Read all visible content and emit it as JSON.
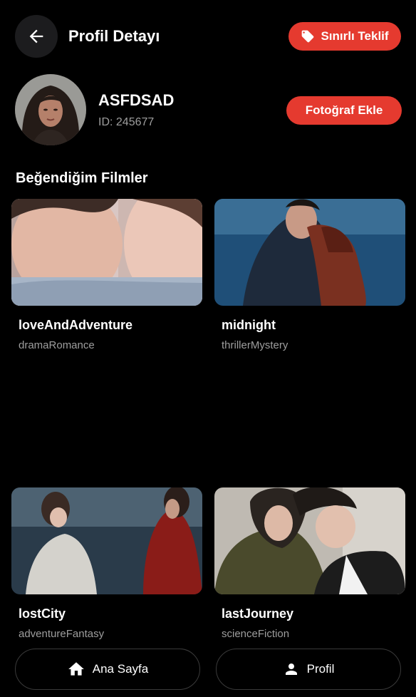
{
  "header": {
    "title": "Profil Detayı",
    "back_icon": "arrow-left-icon",
    "offer_label": "Sınırlı Teklif",
    "offer_icon": "tag-icon"
  },
  "profile": {
    "username": "ASFDSAD",
    "id_text": "ID: 245677",
    "add_photo_label": "Fotoğraf Ekle"
  },
  "favorites": {
    "title": "Beğendiğim Filmler",
    "movies": [
      {
        "name": "loveAndAdventure",
        "genre": "dramaRomance"
      },
      {
        "name": "midnight",
        "genre": "thrillerMystery"
      },
      {
        "name": "lostCity",
        "genre": "adventureFantasy"
      },
      {
        "name": "lastJourney",
        "genre": "scienceFiction"
      }
    ]
  },
  "bottom_nav": {
    "home_label": "Ana Sayfa",
    "home_icon": "home-icon",
    "profile_label": "Profil",
    "profile_icon": "person-icon"
  },
  "colors": {
    "accent": "#e53a2f",
    "background": "#000000",
    "muted_text": "#9e9e9e"
  }
}
